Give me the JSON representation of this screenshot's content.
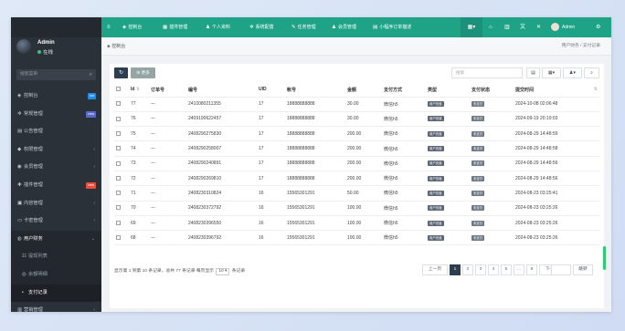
{
  "sidebar": {
    "user": {
      "name": "Admin",
      "status": "在线"
    },
    "search_placeholder": "搜索菜单",
    "items": [
      {
        "icon": "dashboard-icon",
        "glyph": "◈",
        "label": "控制台",
        "badge": "hot",
        "badge_color": "#1f8ce6"
      },
      {
        "icon": "config-icon",
        "glyph": "✲",
        "label": "常规管理",
        "badge": "new",
        "badge_color": "#5969c9"
      },
      {
        "icon": "article-icon",
        "glyph": "▤",
        "label": "公告管理"
      },
      {
        "icon": "permission-icon",
        "glyph": "◆",
        "label": "权限管理",
        "chevron": "‹"
      },
      {
        "icon": "member-icon",
        "glyph": "◉",
        "label": "会员管理",
        "chevron": "‹"
      },
      {
        "icon": "plugin-icon",
        "glyph": "✚",
        "label": "插件管理",
        "badge": "new",
        "badge_color": "#e74c3c"
      },
      {
        "icon": "content-icon",
        "glyph": "▣",
        "label": "内容管理",
        "chevron": "‹"
      },
      {
        "icon": "card-icon",
        "glyph": "▭",
        "label": "卡密管理",
        "chevron": "‹"
      },
      {
        "icon": "finance-icon",
        "glyph": "◍",
        "label": "用户财务",
        "chevron": "⌄",
        "open": true
      },
      {
        "icon": "list-icon",
        "glyph": "☷",
        "label": "提现列表",
        "sub": true
      },
      {
        "icon": "balance-icon",
        "glyph": "◎",
        "label": "余额明细",
        "sub": true
      },
      {
        "icon": "pay-icon",
        "glyph": "▪",
        "label": "支付记录",
        "sub": true,
        "active": true
      },
      {
        "icon": "marketing-icon",
        "glyph": "▥",
        "label": "营销管理",
        "chevron": "‹"
      }
    ]
  },
  "topbar": {
    "items": [
      {
        "icon": "dashboard-icon",
        "glyph": "◈",
        "label": "控制台"
      },
      {
        "icon": "plugin-icon",
        "glyph": "▦",
        "label": "插件管理"
      },
      {
        "icon": "user-icon",
        "glyph": "♟",
        "label": "个人资料"
      },
      {
        "icon": "settings-icon",
        "glyph": "✲",
        "label": "系统配置"
      },
      {
        "icon": "task-icon",
        "glyph": "✎",
        "label": "任务管理"
      },
      {
        "icon": "member-icon",
        "glyph": "♟",
        "label": "会员管理"
      },
      {
        "icon": "order-icon",
        "glyph": "▤",
        "label": "小程序订单描述"
      }
    ],
    "admin_name": "Admin"
  },
  "breadcrumb": {
    "current": "控制台",
    "path": "用户财务 / 支付记录"
  },
  "toolbar": {
    "refresh_glyph": "↻",
    "more_label": "更多",
    "search_placeholder": "搜索"
  },
  "table": {
    "headers": [
      "Id",
      "订单号",
      "编号",
      "UID",
      "帐号",
      "金额",
      "支付方式",
      "类型",
      "支付状态",
      "提交时间"
    ],
    "rows": [
      [
        "77",
        "---",
        "2410080211355",
        "17",
        "18888888888",
        "30.00",
        "微信h5",
        "用户充值",
        "未支付",
        "2024-10-08 02:06:48"
      ],
      [
        "76",
        "---",
        "2409190622457",
        "17",
        "18888888888",
        "30.00",
        "微信h5",
        "用户充值",
        "未支付",
        "2024-09-19 20:19:03"
      ],
      [
        "75",
        "---",
        "2408290275830",
        "17",
        "18888888888",
        "200.00",
        "微信h5",
        "用户充值",
        "未支付",
        "2024-08-29 14:48:59"
      ],
      [
        "74",
        "---",
        "2408290258007",
        "17",
        "18888888888",
        "200.00",
        "微信h5",
        "用户充值",
        "未支付",
        "2024-08-29 14:48:58"
      ],
      [
        "73",
        "---",
        "2408290240891",
        "17",
        "18888888888",
        "200.00",
        "微信h5",
        "用户充值",
        "未支付",
        "2024-08-29 14:48:56"
      ],
      [
        "72",
        "---",
        "2408290269810",
        "17",
        "18888888888",
        "200.00",
        "微信h5",
        "用户充值",
        "未支付",
        "2024-08-29 14:48:56"
      ],
      [
        "71",
        "---",
        "2408230310824",
        "16",
        "15565301291",
        "50.00",
        "微信h5",
        "用户充值",
        "未支付",
        "2024-08-23 03:25:41"
      ],
      [
        "70",
        "---",
        "2408230372792",
        "16",
        "15565301291",
        "100.00",
        "微信h5",
        "用户充值",
        "未支付",
        "2024-08-23 03:25:26"
      ],
      [
        "69",
        "---",
        "2408230396550",
        "16",
        "15565301291",
        "100.00",
        "微信h5",
        "用户充值",
        "未支付",
        "2024-08-23 03:25:26"
      ],
      [
        "68",
        "---",
        "2408230396792",
        "16",
        "15565301291",
        "100.00",
        "微信h5",
        "用户充值",
        "未支付",
        "2024-08-23 03:25:26"
      ]
    ]
  },
  "pagination": {
    "info_prefix": "显示第 1 到第 10 条记录，总共 77 条记录 每页显示",
    "per_page": "10",
    "info_suffix": "条记录",
    "prev": "上一页",
    "pages": [
      "1",
      "2",
      "3",
      "4",
      "5",
      "...",
      "8"
    ],
    "next": "下一页",
    "jump": "跳转"
  },
  "colors": {
    "topbar": "#1fa387",
    "sidebar": "#2b3139",
    "primary": "#2c3e50"
  }
}
